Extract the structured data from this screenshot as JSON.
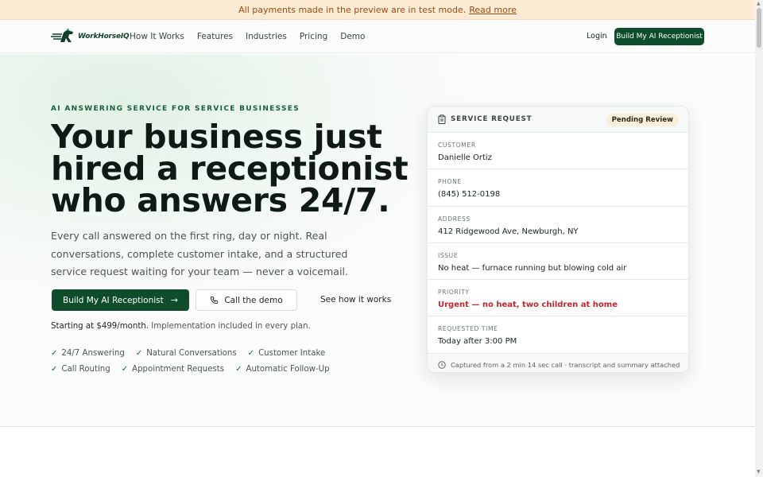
{
  "banner": {
    "text": "All payments made in the preview are in test mode.",
    "link": "Read more"
  },
  "nav": {
    "logo_text": "WorkHorseIQ",
    "links": [
      "How It Works",
      "Features",
      "Industries",
      "Pricing",
      "Demo"
    ],
    "login": "Login",
    "cta": "Build My AI Receptionist"
  },
  "hero": {
    "eyebrow": "AI ANSWERING SERVICE FOR SERVICE BUSINESSES",
    "headline": "Your business just hired a receptionist who answers 24/7.",
    "subheadline": "Every call answered on the first ring, day or night. Real conversations, complete customer intake, and a structured service request waiting for your team — never a voicemail.",
    "primary_cta": "Build My AI Receptionist",
    "secondary_cta": "Call the demo",
    "link_cta": "See how it works",
    "pricing_bold": "Starting at $499/month.",
    "pricing_rest": "Implementation included in every plan.",
    "features": [
      "24/7 Answering",
      "Natural Conversations",
      "Customer Intake",
      "Call Routing",
      "Appointment Requests",
      "Automatic Follow-Up"
    ]
  },
  "card": {
    "title": "SERVICE REQUEST",
    "badge": "Pending Review",
    "fields": [
      {
        "label": "CUSTOMER",
        "value": "Danielle Ortiz"
      },
      {
        "label": "PHONE",
        "value": "(845) 512-0198"
      },
      {
        "label": "ADDRESS",
        "value": "412 Ridgewood Ave, Newburgh, NY"
      },
      {
        "label": "ISSUE",
        "value": "No heat — furnace running but blowing cold air"
      },
      {
        "label": "PRIORITY",
        "value": "Urgent — no heat, two children at home"
      },
      {
        "label": "REQUESTED TIME",
        "value": "Today after 3:00 PM"
      }
    ],
    "footer": "Captured from a 2 min 14 sec call · transcript and summary attached"
  },
  "colors": {
    "brand": "#0e4d2c",
    "banner_bg": "#fdecd3",
    "urgent": "#c0262d",
    "badge_bg": "#fbeedb"
  },
  "icons": [
    "logo-horse-icon",
    "arrow-right-icon",
    "phone-icon",
    "check-icon",
    "clipboard-icon",
    "clock-icon"
  ]
}
